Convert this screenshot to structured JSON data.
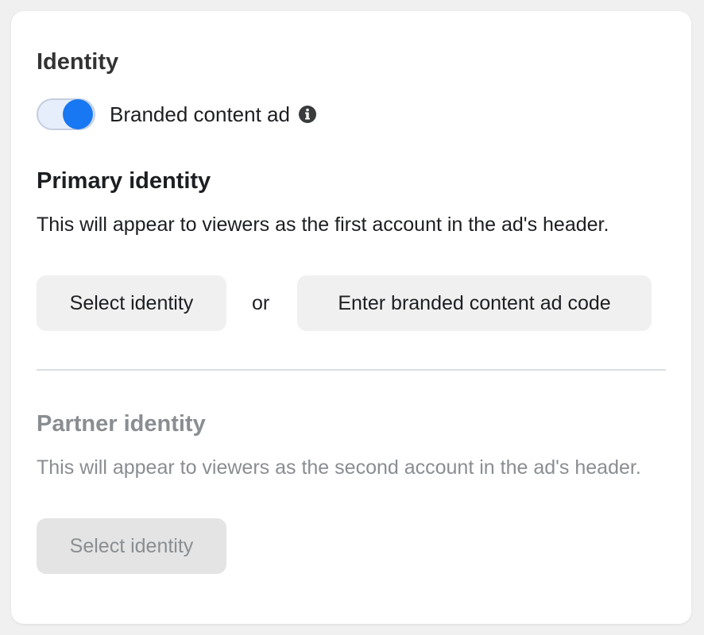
{
  "identity": {
    "title": "Identity",
    "branded_content_toggle": {
      "label": "Branded content ad",
      "on": true,
      "info_icon": "info-circle-icon"
    }
  },
  "primary_identity": {
    "title": "Primary identity",
    "description": "This will appear to viewers as the first account in the ad's header.",
    "select_button": "Select identity",
    "or_label": "or",
    "code_button": "Enter branded content ad code"
  },
  "partner_identity": {
    "title": "Partner identity",
    "description": "This will appear to viewers as the second account in the ad's header.",
    "select_button": "Select identity",
    "disabled": true
  },
  "colors": {
    "accent": "#1877f2",
    "toggle_track": "#e7eefb",
    "text_primary": "#1c1e21",
    "text_disabled": "#8a8d91",
    "button_bg": "#f0f0f0"
  }
}
